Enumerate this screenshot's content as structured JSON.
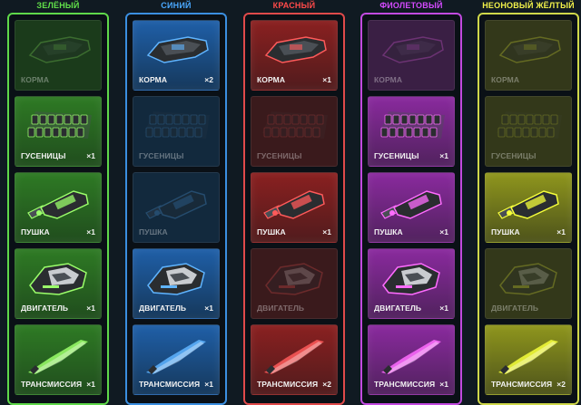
{
  "parts": {
    "stern": "КОРМА",
    "tracks": "ГУСЕНИЦЫ",
    "cannon": "ПУШКА",
    "engine": "ДВИГАТЕЛЬ",
    "transmission": "ТРАНСМИССИЯ"
  },
  "columns": [
    {
      "title": "ЗЕЛЁНЫЙ",
      "title_color": "#62e24a",
      "border": "#5fd84a",
      "slot_fill": "#2e7a24",
      "empty_fill": "#1b3b1b",
      "accent": "#9bff6a",
      "counts": {
        "stern": "",
        "tracks": "×1",
        "cannon": "×1",
        "engine": "×1",
        "transmission": "×1"
      }
    },
    {
      "title": "СИНИЙ",
      "title_color": "#4aa8ff",
      "border": "#3b8fe0",
      "slot_fill": "#1f5fa8",
      "empty_fill": "#12293d",
      "accent": "#5fb4ff",
      "counts": {
        "stern": "×2",
        "tracks": "",
        "cannon": "",
        "engine": "×1",
        "transmission": "×1"
      }
    },
    {
      "title": "КРАСНЫЙ",
      "title_color": "#ff4a4a",
      "border": "#e04a4a",
      "slot_fill": "#8a2020",
      "empty_fill": "#3a1a1c",
      "accent": "#ff5a5a",
      "counts": {
        "stern": "×1",
        "tracks": "",
        "cannon": "×1",
        "engine": "",
        "transmission": "×2"
      }
    },
    {
      "title": "ФИОЛЕТОВЫЙ",
      "title_color": "#d44aff",
      "border": "#c24ae0",
      "slot_fill": "#8a2a9e",
      "empty_fill": "#3a1f44",
      "accent": "#ff6cff",
      "counts": {
        "stern": "",
        "tracks": "×1",
        "cannon": "×1",
        "engine": "×1",
        "transmission": "×1"
      }
    },
    {
      "title": "НЕОНОВЫЙ ЖЁЛТЫЙ",
      "title_color": "#f2f24a",
      "border": "#cfd84a",
      "slot_fill": "#8f961d",
      "empty_fill": "#33381a",
      "accent": "#f6ff3a",
      "counts": {
        "stern": "",
        "tracks": "",
        "cannon": "×1",
        "engine": "",
        "transmission": "×2"
      }
    }
  ]
}
